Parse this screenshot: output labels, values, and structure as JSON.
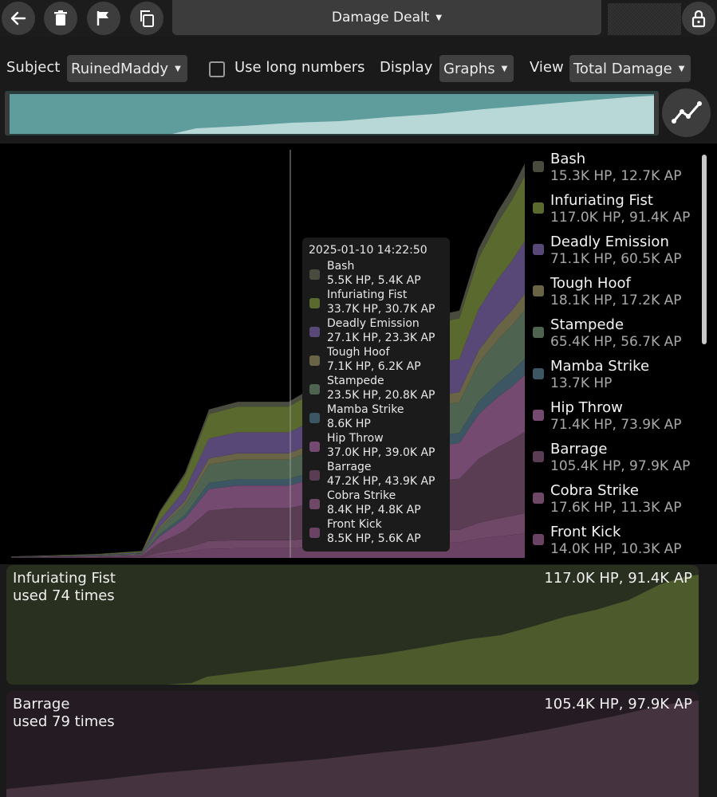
{
  "toolbar": {
    "title": "Damage Dealt",
    "buttons": [
      "back-arrow-icon",
      "trash-icon",
      "flag-icon",
      "copy-icon",
      "lock-icon"
    ]
  },
  "controls": {
    "subject_label": "Subject",
    "subject_value": "RuinedMaddy",
    "long_numbers_label": "Use long numbers",
    "long_numbers_checked": false,
    "display_label": "Display",
    "display_value": "Graphs",
    "view_label": "View",
    "view_value": "Total Damage"
  },
  "legend": [
    {
      "name": "Bash",
      "value": "15.3K HP, 12.7K AP",
      "color": "#4a4b3f"
    },
    {
      "name": "Infuriating Fist",
      "value": "117.0K HP, 91.4K AP",
      "color": "#5a6a2e"
    },
    {
      "name": "Deadly Emission",
      "value": "71.1K HP, 60.5K AP",
      "color": "#574878"
    },
    {
      "name": "Tough Hoof",
      "value": "18.1K HP, 17.2K AP",
      "color": "#686445"
    },
    {
      "name": "Stampede",
      "value": "65.4K HP, 56.7K AP",
      "color": "#4f6450"
    },
    {
      "name": "Mamba Strike",
      "value": "13.7K HP",
      "color": "#3c5664"
    },
    {
      "name": "Hip Throw",
      "value": "71.4K HP, 73.9K AP",
      "color": "#744a70"
    },
    {
      "name": "Barrage",
      "value": "105.4K HP, 97.9K AP",
      "color": "#5a3d52"
    },
    {
      "name": "Cobra Strike",
      "value": "17.6K HP, 11.3K AP",
      "color": "#6e4866"
    },
    {
      "name": "Front Kick",
      "value": "14.0K HP, 10.3K AP",
      "color": "#6a4264"
    }
  ],
  "tooltip": {
    "timestamp": "2025-01-10 14:22:50",
    "items": [
      {
        "name": "Bash",
        "value": "5.5K HP, 5.4K AP",
        "color": "#4a4b3f"
      },
      {
        "name": "Infuriating Fist",
        "value": "33.7K HP, 30.7K AP",
        "color": "#5a6a2e"
      },
      {
        "name": "Deadly Emission",
        "value": "27.1K HP, 23.3K AP",
        "color": "#574878"
      },
      {
        "name": "Tough Hoof",
        "value": "7.1K HP, 6.2K AP",
        "color": "#686445"
      },
      {
        "name": "Stampede",
        "value": "23.5K HP, 20.8K AP",
        "color": "#4f6450"
      },
      {
        "name": "Mamba Strike",
        "value": "8.6K HP",
        "color": "#3c5664"
      },
      {
        "name": "Hip Throw",
        "value": "37.0K HP, 39.0K AP",
        "color": "#744a70"
      },
      {
        "name": "Barrage",
        "value": "47.2K HP, 43.9K AP",
        "color": "#5a3d52"
      },
      {
        "name": "Cobra Strike",
        "value": "8.4K HP, 4.8K AP",
        "color": "#6e4866"
      },
      {
        "name": "Front Kick",
        "value": "8.5K HP, 5.6K AP",
        "color": "#6a4264"
      }
    ]
  },
  "cards": [
    {
      "name": "Infuriating Fist",
      "uses": "used 74 times",
      "total": "117.0K HP, 91.4K AP",
      "bg": "#2a3020",
      "fill": "#4d5a2c"
    },
    {
      "name": "Barrage",
      "uses": "used 79 times",
      "total": "105.4K HP, 97.9K AP",
      "bg": "#241c22",
      "fill": "#45343f"
    }
  ],
  "colors": {
    "overview_fill": "#b8d8d8",
    "overview_bg": "#5f9c9c"
  }
}
